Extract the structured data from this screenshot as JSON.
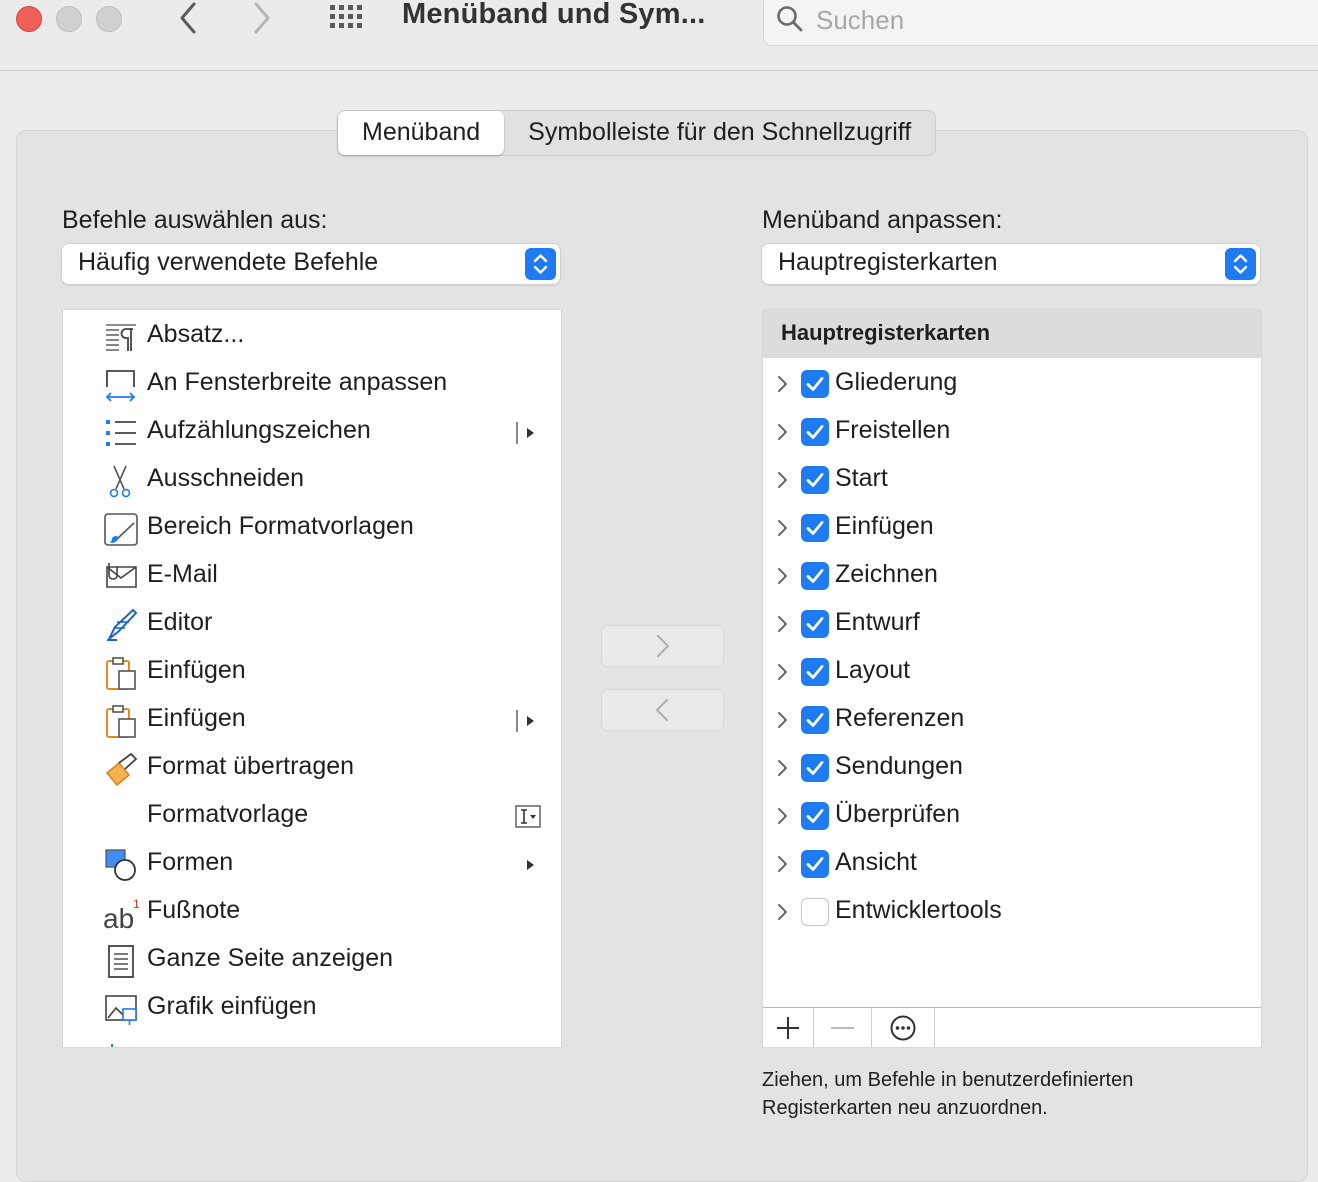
{
  "window": {
    "title": "Menüband und Sym..."
  },
  "search": {
    "placeholder": "Suchen"
  },
  "tabs": [
    {
      "label": "Menüband",
      "active": true
    },
    {
      "label": "Symbolleiste für den Schnellzugriff",
      "active": false
    }
  ],
  "left": {
    "label": "Befehle auswählen aus:",
    "popup_value": "Häufig verwendete Befehle",
    "commands": [
      {
        "label": "Absatz...",
        "icon": "paragraph-icon"
      },
      {
        "label": "An Fensterbreite anpassen",
        "icon": "fit-width-icon"
      },
      {
        "label": "Aufzählungszeichen",
        "icon": "bullets-icon",
        "extra": "split-arrow"
      },
      {
        "label": "Ausschneiden",
        "icon": "scissors-icon"
      },
      {
        "label": "Bereich Formatvorlagen",
        "icon": "styles-pane-icon"
      },
      {
        "label": "E-Mail",
        "icon": "email-icon"
      },
      {
        "label": "Editor",
        "icon": "editor-pen-icon"
      },
      {
        "label": "Einfügen",
        "icon": "clipboard-icon"
      },
      {
        "label": "Einfügen",
        "icon": "clipboard-icon",
        "extra": "split-arrow"
      },
      {
        "label": "Format übertragen",
        "icon": "format-painter-icon"
      },
      {
        "label": "Formatvorlage",
        "icon": "",
        "extra": "style-dropdown"
      },
      {
        "label": "Formen",
        "icon": "shapes-icon",
        "extra": "arrow"
      },
      {
        "label": "Fußnote",
        "icon": "footnote-icon"
      },
      {
        "label": "Ganze Seite anzeigen",
        "icon": "full-page-icon"
      },
      {
        "label": "Grafik einfügen",
        "icon": "insert-picture-icon"
      }
    ]
  },
  "right": {
    "label": "Menüband anpassen:",
    "popup_value": "Hauptregisterkarten",
    "tree_header": "Hauptregisterkarten",
    "tabs": [
      {
        "label": "Gliederung",
        "checked": true
      },
      {
        "label": "Freistellen",
        "checked": true
      },
      {
        "label": "Start",
        "checked": true
      },
      {
        "label": "Einfügen",
        "checked": true
      },
      {
        "label": "Zeichnen",
        "checked": true
      },
      {
        "label": "Entwurf",
        "checked": true
      },
      {
        "label": "Layout",
        "checked": true
      },
      {
        "label": "Referenzen",
        "checked": true
      },
      {
        "label": "Sendungen",
        "checked": true
      },
      {
        "label": "Überprüfen",
        "checked": true
      },
      {
        "label": "Ansicht",
        "checked": true
      },
      {
        "label": "Entwicklertools",
        "checked": false
      }
    ],
    "help_text": "Ziehen, um Befehle in benutzerdefinierten Registerkarten neu anzuordnen."
  },
  "colors": {
    "accent": "#1f7bf2",
    "close": "#ed5f57"
  }
}
